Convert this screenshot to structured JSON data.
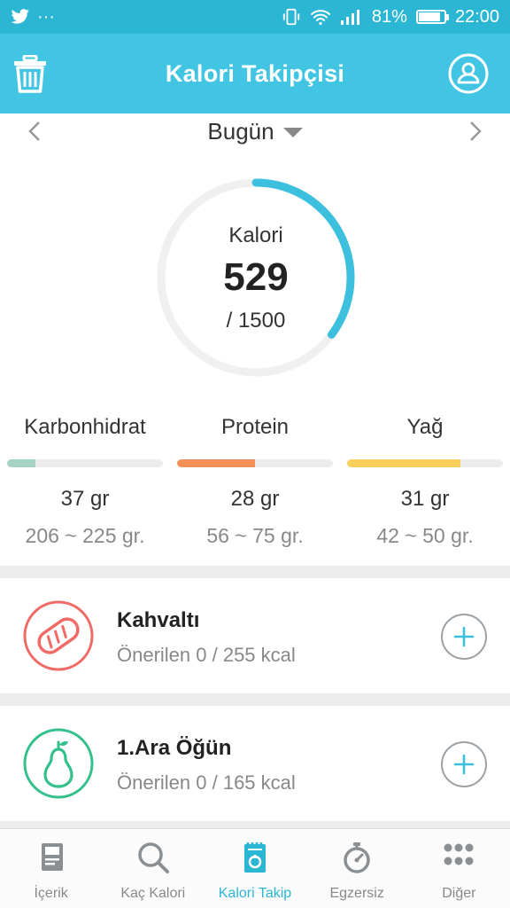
{
  "status_bar": {
    "left_extra": "···",
    "battery": "81%",
    "time": "22:00"
  },
  "app_bar": {
    "title": "Kalori Takipçisi",
    "left_icon": "trash-icon",
    "right_icon": "profile-icon"
  },
  "date": {
    "label": "Bugün"
  },
  "calorie": {
    "label": "Kalori",
    "value": "529",
    "goal_text": "/ 1500",
    "consumed": 529,
    "goal": 1500,
    "ring_color": "#3dbfde"
  },
  "macros": [
    {
      "name": "Karbonhidrat",
      "amount": "37 gr",
      "range": "206 ~ 225 gr.",
      "progress": 0.18,
      "color": "#a6d4c2"
    },
    {
      "name": "Protein",
      "amount": "28 gr",
      "range": "56 ~ 75 gr.",
      "progress": 0.5,
      "color": "#f39058"
    },
    {
      "name": "Yağ",
      "amount": "31 gr",
      "range": "42 ~ 50 gr.",
      "progress": 0.73,
      "color": "#f7cf5a"
    }
  ],
  "meals": [
    {
      "title": "Kahvaltı",
      "subtitle": "Önerilen 0 / 255 kcal",
      "icon": "bread-icon",
      "color": "#f06a66"
    },
    {
      "title": "1.Ara Öğün",
      "subtitle": "Önerilen 0 / 165 kcal",
      "icon": "pear-icon",
      "color": "#33c08a"
    }
  ],
  "tabs": [
    {
      "label": "İçerik",
      "icon": "book-icon"
    },
    {
      "label": "Kaç Kalori",
      "icon": "search-icon"
    },
    {
      "label": "Kalori Takip",
      "icon": "notepad-icon",
      "active": true
    },
    {
      "label": "Egzersiz",
      "icon": "stopwatch-icon"
    },
    {
      "label": "Diğer",
      "icon": "grid-icon"
    }
  ],
  "colors": {
    "brand": "#42c5e2",
    "status_bar": "#2bb6d4",
    "active_tab": "#2bb6d4",
    "inactive_tab": "#8a8f93"
  }
}
